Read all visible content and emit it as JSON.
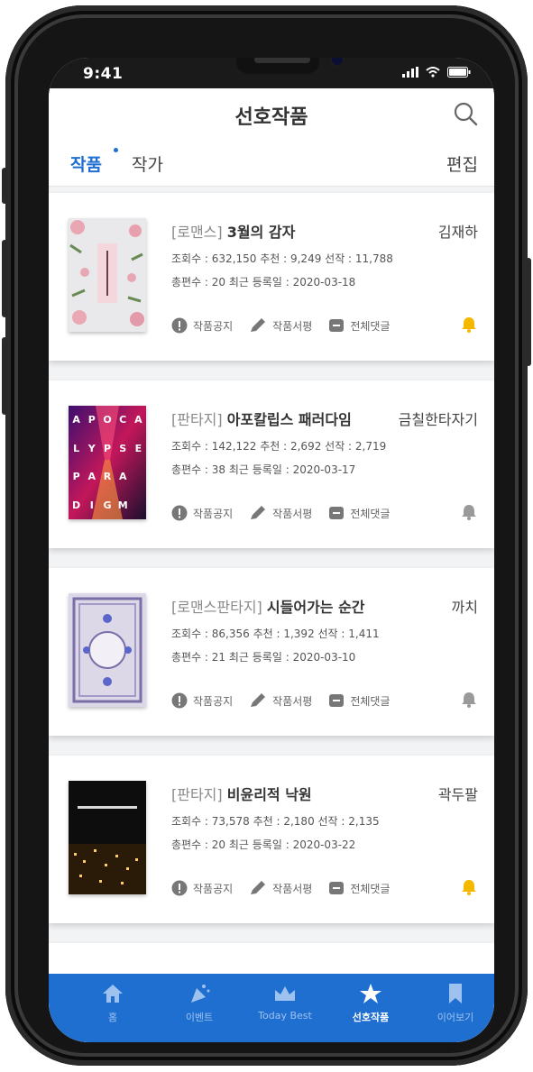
{
  "status": {
    "time": "9:41"
  },
  "header": {
    "title": "선호작품"
  },
  "tabs": {
    "works": "작품",
    "authors": "작가",
    "edit": "편집"
  },
  "actions": {
    "notice": "작품공지",
    "review": "작품서평",
    "comments": "전체댓글"
  },
  "items": [
    {
      "genre": "[로맨스]",
      "title": "3월의 감자",
      "author": "김재하",
      "stats": "조회수 : 632,150   추천 : 9,249   선작 : 11,788",
      "stats2": "총편수 : 20   최근 등록일 : 2020-03-18",
      "bell_on": true
    },
    {
      "genre": "[판타지]",
      "title": "아포칼립스 패러다임",
      "author": "금칠한타자기",
      "stats": "조회수 : 142,122   추천 : 2,692   선작 : 2,719",
      "stats2": "총편수 : 38   최근 등록일 : 2020-03-17",
      "bell_on": false,
      "cover_letters": [
        "A",
        "P",
        "O",
        "C",
        "A",
        "L",
        "Y",
        "P",
        "S",
        "E",
        "P",
        "A",
        "R",
        "A",
        "D",
        "I",
        "G",
        "M"
      ]
    },
    {
      "genre": "[로맨스판타지]",
      "title": "시들어가는 순간",
      "author": "까치",
      "stats": "조회수 : 86,356   추천 : 1,392   선작 : 1,411",
      "stats2": "총편수 : 21   최근 등록일 : 2020-03-10",
      "bell_on": false
    },
    {
      "genre": "[판타지]",
      "title": "비윤리적 낙원",
      "author": "곽두팔",
      "stats": "조회수 : 73,578   추천 : 2,180   선작 : 2,135",
      "stats2": "총편수 : 20   최근 등록일 : 2020-03-22",
      "bell_on": true
    }
  ],
  "tabbar": [
    {
      "label": "홈",
      "icon": "home-icon"
    },
    {
      "label": "이벤트",
      "icon": "party-icon"
    },
    {
      "label": "Today Best",
      "icon": "crown-icon"
    },
    {
      "label": "선호작품",
      "icon": "star-icon",
      "active": true
    },
    {
      "label": "이어보기",
      "icon": "bookmark-icon"
    }
  ],
  "colors": {
    "accent": "#1f6fd1",
    "bell_on": "#f5b800",
    "bell_off": "#9a9a9a"
  }
}
